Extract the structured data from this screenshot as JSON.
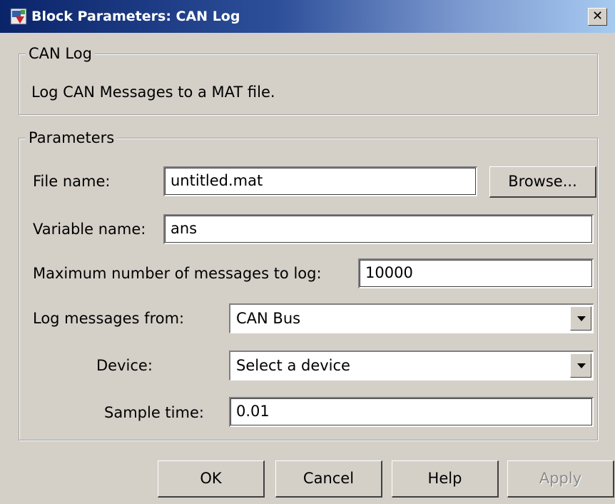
{
  "window": {
    "title": "Block Parameters: CAN Log",
    "close_label": "✕"
  },
  "description_group": {
    "legend": "CAN Log",
    "text": "Log CAN Messages to a MAT file."
  },
  "parameters_group": {
    "legend": "Parameters",
    "file_name": {
      "label": "File name:",
      "value": "untitled.mat",
      "browse_label": "Browse..."
    },
    "variable_name": {
      "label": "Variable name:",
      "value": "ans"
    },
    "max_messages": {
      "label": "Maximum number of messages to log:",
      "value": "10000"
    },
    "log_from": {
      "label": "Log messages from:",
      "value": "CAN Bus"
    },
    "device": {
      "label": "Device:",
      "value": "Select a device"
    },
    "sample_time": {
      "label": "Sample time:",
      "value": "0.01"
    }
  },
  "buttons": {
    "ok": "OK",
    "cancel": "Cancel",
    "help": "Help",
    "apply": "Apply"
  },
  "icons": {
    "app": "simulink-block-icon",
    "close": "close-icon",
    "dropdown": "chevron-down-icon"
  }
}
